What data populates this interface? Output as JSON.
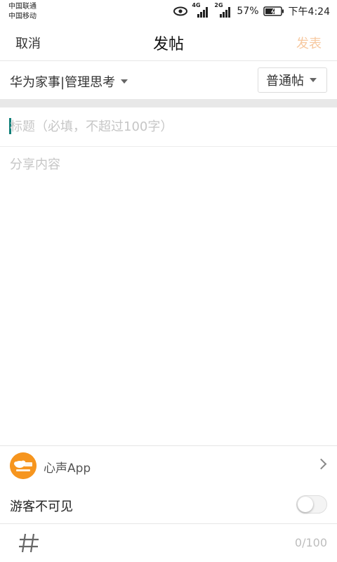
{
  "status_bar": {
    "carrier1": "中国联通",
    "carrier2": "中国移动",
    "signal1_label": "4G",
    "signal2_label": "2G",
    "battery": "57%",
    "time": "下午4:24"
  },
  "nav": {
    "cancel": "取消",
    "title": "发帖",
    "publish": "发表"
  },
  "board": {
    "name": "华为家事|管理思考",
    "post_type": "普通帖"
  },
  "title_input": {
    "placeholder": "标题（必填，不超过100字）",
    "value": ""
  },
  "content_input": {
    "placeholder": "分享内容",
    "value": ""
  },
  "source": {
    "name": "心声App",
    "icon": "app-logo-icon"
  },
  "guest": {
    "label": "游客不可见",
    "enabled": false
  },
  "footer": {
    "counter": "0/100",
    "topic_icon": "hash-icon"
  },
  "colors": {
    "publish_disabled": "#f7c9a0",
    "cursor": "#0f7f78",
    "avatar_bg": "#f6951e"
  }
}
